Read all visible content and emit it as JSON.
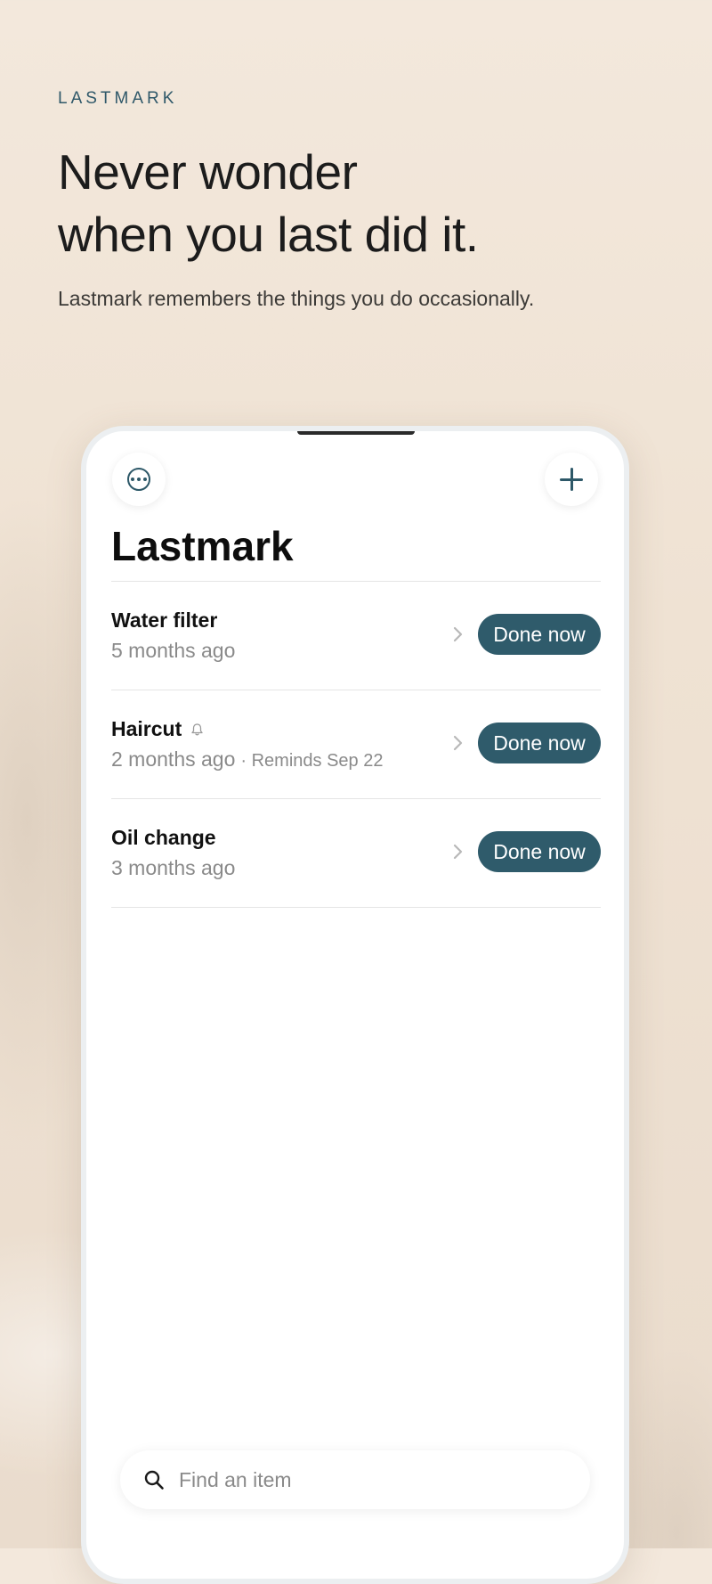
{
  "hero": {
    "brand": "LASTMARK",
    "headline_line1": "Never wonder",
    "headline_line2": "when you last did it.",
    "subline": "Lastmark remembers the things you do occasionally."
  },
  "app": {
    "title": "Lastmark",
    "icons": {
      "more": "more-icon",
      "add": "plus-icon",
      "reminder": "bell-icon",
      "row_nav": "chevron-right-icon",
      "search": "search-icon"
    },
    "items": [
      {
        "title": "Water filter",
        "last_done": "5 months ago",
        "reminder": "",
        "action": "Done now"
      },
      {
        "title": "Haircut",
        "last_done": "2 months ago",
        "reminder": "· Reminds Sep 22",
        "action": "Done now"
      },
      {
        "title": "Oil change",
        "last_done": "3 months ago",
        "reminder": "",
        "action": "Done now"
      }
    ],
    "search": {
      "placeholder": "Find an item",
      "value": ""
    }
  },
  "colors": {
    "accent": "#2f5b6b",
    "brand_text": "#2f5869",
    "background": "#f1e5d8",
    "divider": "#e5e5e5",
    "secondary_text": "#8a8a8a"
  }
}
